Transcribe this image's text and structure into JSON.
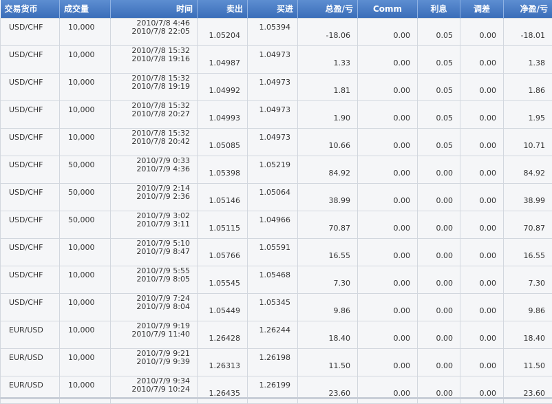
{
  "table": {
    "headers": {
      "symbol": "交易货币",
      "volume": "成交量",
      "time": "时间",
      "sell": "卖出",
      "buy": "买进",
      "gross_pl": "总盈/亏",
      "comm": "Comm",
      "interest": "利息",
      "adjust": "调差",
      "net_pl": "净盈/亏"
    },
    "rows": [
      {
        "symbol": "USD/CHF",
        "volume": "10,000",
        "open_time": "2010/7/8 4:46",
        "close_time": "2010/7/8 22:05",
        "sell": "1.05204",
        "buy": "1.05394",
        "gross": "-18.06",
        "comm": "0.00",
        "interest": "0.05",
        "adjust": "0.00",
        "net": "-18.01"
      },
      {
        "symbol": "USD/CHF",
        "volume": "10,000",
        "open_time": "2010/7/8 15:32",
        "close_time": "2010/7/8 19:16",
        "sell": "1.04987",
        "buy": "1.04973",
        "gross": "1.33",
        "comm": "0.00",
        "interest": "0.05",
        "adjust": "0.00",
        "net": "1.38"
      },
      {
        "symbol": "USD/CHF",
        "volume": "10,000",
        "open_time": "2010/7/8 15:32",
        "close_time": "2010/7/8 19:19",
        "sell": "1.04992",
        "buy": "1.04973",
        "gross": "1.81",
        "comm": "0.00",
        "interest": "0.05",
        "adjust": "0.00",
        "net": "1.86"
      },
      {
        "symbol": "USD/CHF",
        "volume": "10,000",
        "open_time": "2010/7/8 15:32",
        "close_time": "2010/7/8 20:27",
        "sell": "1.04993",
        "buy": "1.04973",
        "gross": "1.90",
        "comm": "0.00",
        "interest": "0.05",
        "adjust": "0.00",
        "net": "1.95"
      },
      {
        "symbol": "USD/CHF",
        "volume": "10,000",
        "open_time": "2010/7/8 15:32",
        "close_time": "2010/7/8 20:42",
        "sell": "1.05085",
        "buy": "1.04973",
        "gross": "10.66",
        "comm": "0.00",
        "interest": "0.05",
        "adjust": "0.00",
        "net": "10.71"
      },
      {
        "symbol": "USD/CHF",
        "volume": "50,000",
        "open_time": "2010/7/9 0:33",
        "close_time": "2010/7/9 4:36",
        "sell": "1.05398",
        "buy": "1.05219",
        "gross": "84.92",
        "comm": "0.00",
        "interest": "0.00",
        "adjust": "0.00",
        "net": "84.92"
      },
      {
        "symbol": "USD/CHF",
        "volume": "50,000",
        "open_time": "2010/7/9 2:14",
        "close_time": "2010/7/9 2:36",
        "sell": "1.05146",
        "buy": "1.05064",
        "gross": "38.99",
        "comm": "0.00",
        "interest": "0.00",
        "adjust": "0.00",
        "net": "38.99"
      },
      {
        "symbol": "USD/CHF",
        "volume": "50,000",
        "open_time": "2010/7/9 3:02",
        "close_time": "2010/7/9 3:11",
        "sell": "1.05115",
        "buy": "1.04966",
        "gross": "70.87",
        "comm": "0.00",
        "interest": "0.00",
        "adjust": "0.00",
        "net": "70.87"
      },
      {
        "symbol": "USD/CHF",
        "volume": "10,000",
        "open_time": "2010/7/9 5:10",
        "close_time": "2010/7/9 8:47",
        "sell": "1.05766",
        "buy": "1.05591",
        "gross": "16.55",
        "comm": "0.00",
        "interest": "0.00",
        "adjust": "0.00",
        "net": "16.55"
      },
      {
        "symbol": "USD/CHF",
        "volume": "10,000",
        "open_time": "2010/7/9 5:55",
        "close_time": "2010/7/9 8:05",
        "sell": "1.05545",
        "buy": "1.05468",
        "gross": "7.30",
        "comm": "0.00",
        "interest": "0.00",
        "adjust": "0.00",
        "net": "7.30"
      },
      {
        "symbol": "USD/CHF",
        "volume": "10,000",
        "open_time": "2010/7/9 7:24",
        "close_time": "2010/7/9 8:04",
        "sell": "1.05449",
        "buy": "1.05345",
        "gross": "9.86",
        "comm": "0.00",
        "interest": "0.00",
        "adjust": "0.00",
        "net": "9.86"
      },
      {
        "symbol": "EUR/USD",
        "volume": "10,000",
        "open_time": "2010/7/9 9:19",
        "close_time": "2010/7/9 11:40",
        "sell": "1.26428",
        "buy": "1.26244",
        "gross": "18.40",
        "comm": "0.00",
        "interest": "0.00",
        "adjust": "0.00",
        "net": "18.40"
      },
      {
        "symbol": "EUR/USD",
        "volume": "10,000",
        "open_time": "2010/7/9 9:21",
        "close_time": "2010/7/9 9:39",
        "sell": "1.26313",
        "buy": "1.26198",
        "gross": "11.50",
        "comm": "0.00",
        "interest": "0.00",
        "adjust": "0.00",
        "net": "11.50"
      },
      {
        "symbol": "EUR/USD",
        "volume": "10,000",
        "open_time": "2010/7/9 9:34",
        "close_time": "2010/7/9 10:24",
        "sell": "1.26435",
        "buy": "1.26199",
        "gross": "23.60",
        "comm": "0.00",
        "interest": "0.00",
        "adjust": "0.00",
        "net": "23.60"
      }
    ]
  },
  "colors": {
    "header_background": "#3a6db9",
    "header_text": "#ffffff",
    "row_background": "#f5f6f8",
    "grid_line": "#d2d7de"
  }
}
